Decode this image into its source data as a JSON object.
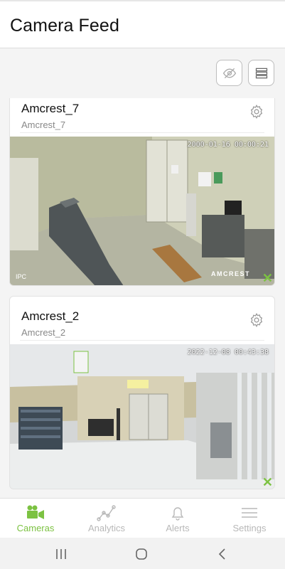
{
  "header": {
    "title": "Camera Feed"
  },
  "toolbar": {
    "hide_icon": "eye-off-icon",
    "layout_icon": "list-layout-icon"
  },
  "cameras": [
    {
      "name": "Amcrest_7",
      "subtitle": "Amcrest_7",
      "timestamp": "2000-01-16 00:00:21",
      "overlay_left": "IPC",
      "overlay_brand": "AMCREST",
      "status_mark": "✕"
    },
    {
      "name": "Amcrest_2",
      "subtitle": "Amcrest_2",
      "timestamp": "2022-12-08 00:43:38",
      "status_mark": "✕"
    }
  ],
  "nav": {
    "items": [
      {
        "label": "Cameras",
        "icon": "video-camera-icon",
        "active": true
      },
      {
        "label": "Analytics",
        "icon": "analytics-icon",
        "active": false
      },
      {
        "label": "Alerts",
        "icon": "bell-icon",
        "active": false
      },
      {
        "label": "Settings",
        "icon": "menu-icon",
        "active": false
      }
    ]
  },
  "colors": {
    "accent": "#7cc242",
    "inactive": "#b8b8b8"
  }
}
